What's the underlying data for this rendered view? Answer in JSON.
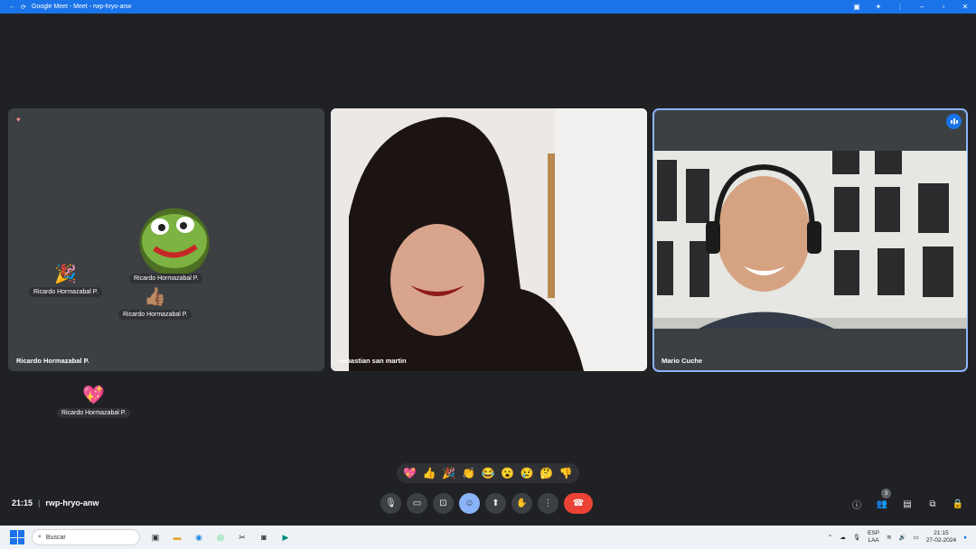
{
  "window": {
    "title": "Google Meet - Meet - rwp-hryo-anw"
  },
  "tiles": [
    {
      "name": "Ricardo Hormazabal P."
    },
    {
      "name": "sebastian san martin"
    },
    {
      "name": "Mario Cuche"
    }
  ],
  "floating_reactions": [
    {
      "emoji": "🎉",
      "name": "Ricardo Hormazabal P."
    },
    {
      "emoji": "👍🏽",
      "name": "Ricardo Hormazabal P."
    },
    {
      "emoji": "🦎",
      "name": "Ricardo Hormazabal P."
    },
    {
      "emoji": "💖",
      "name": "Ricardo Hormazabal P."
    }
  ],
  "reaction_bar": [
    "💖",
    "👍",
    "🎉",
    "👏",
    "😂",
    "😮",
    "😢",
    "🤔",
    "👎"
  ],
  "meeting": {
    "time": "21:15",
    "separator": "|",
    "code": "rwp-hryo-anw"
  },
  "controls": [
    {
      "name": "mic-button",
      "glyph": "🎙"
    },
    {
      "name": "camera-button",
      "glyph": "▭"
    },
    {
      "name": "captions-button",
      "glyph": "⊡"
    },
    {
      "name": "emoji-button",
      "glyph": "☺"
    },
    {
      "name": "present-button",
      "glyph": "⬆"
    },
    {
      "name": "raise-hand-button",
      "glyph": "✋"
    },
    {
      "name": "more-options-button",
      "glyph": "⋮"
    },
    {
      "name": "leave-call-button",
      "glyph": "☎"
    }
  ],
  "right_controls": {
    "participants_count": "3"
  },
  "taskbar": {
    "search_placeholder": "Buscar",
    "lang_top": "ESP",
    "lang_bottom": "LAA",
    "clock_time": "21:15",
    "clock_date": "27-02-2024"
  },
  "colors": {
    "accent": "#1a73e8",
    "background": "#202124",
    "tile": "#3c4043",
    "end_call": "#ea4335",
    "active_speaker_outline": "#8ab4f8"
  }
}
